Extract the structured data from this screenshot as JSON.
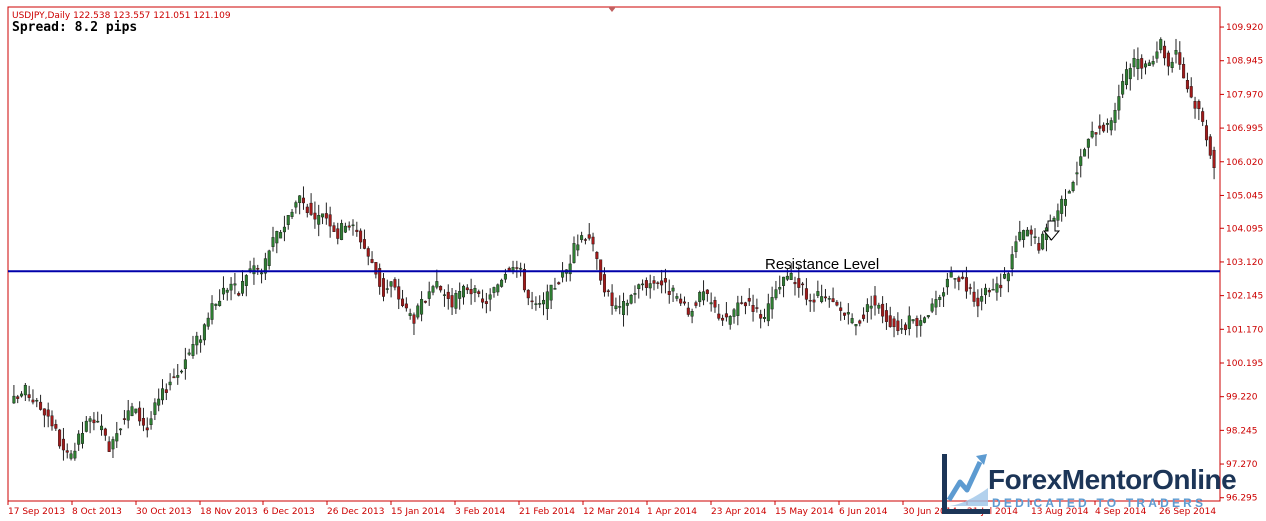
{
  "header": {
    "symbol_line": "USDJPY,Daily  122.538 123.557 121.051 121.109",
    "spread": "Spread: 8.2 pips"
  },
  "colors": {
    "frame": "#cc0000",
    "axis_text": "#cc0000",
    "bull_candle": "#2e7d32",
    "bear_candle": "#a11a1a",
    "wick": "#222222",
    "resistance_line": "#0000aa",
    "logo_dark": "#1c3557",
    "logo_accent": "#5d9bd1"
  },
  "logo": {
    "name": "ForexMentorOnline",
    "tagline": "DEDICATED TO TRADERS",
    "mark_icon": "chart-arrow-icon"
  },
  "annotation": {
    "label": "Resistance Level",
    "arrow_icon": "down-arrow-icon",
    "arrow_date": "13 Aug 2014"
  },
  "chart_data": {
    "type": "candlestick",
    "title": "USDJPY,Daily",
    "ylim": [
      96.2,
      110.5
    ],
    "y_ticks": [
      "109.920",
      "108.945",
      "107.970",
      "106.995",
      "106.020",
      "105.045",
      "104.095",
      "103.120",
      "102.145",
      "101.170",
      "100.195",
      "99.220",
      "98.245",
      "97.270",
      "96.295"
    ],
    "x_ticks": [
      "17 Sep 2013",
      "8 Oct 2013",
      "30 Oct 2013",
      "18 Nov 2013",
      "6 Dec 2013",
      "26 Dec 2013",
      "15 Jan 2014",
      "3 Feb 2014",
      "21 Feb 2014",
      "12 Mar 2014",
      "1 Apr 2014",
      "23 Apr 2014",
      "15 May 2014",
      "6 Jun 2014",
      "30 Jun 2014",
      "21 Jul 2014",
      "13 Aug 2014",
      "4 Sep 2014",
      "26 Sep 2014"
    ],
    "resistance_level": 102.85,
    "close_path": [
      [
        0,
        99.1
      ],
      [
        3,
        99.4
      ],
      [
        6,
        99.0
      ],
      [
        9,
        98.7
      ],
      [
        11,
        98.2
      ],
      [
        13,
        97.6
      ],
      [
        15,
        97.4
      ],
      [
        17,
        98.0
      ],
      [
        19,
        98.4
      ],
      [
        21,
        98.6
      ],
      [
        23,
        98.2
      ],
      [
        25,
        97.8
      ],
      [
        27,
        98.3
      ],
      [
        29,
        98.6
      ],
      [
        31,
        98.9
      ],
      [
        33,
        98.6
      ],
      [
        35,
        98.3
      ],
      [
        37,
        98.9
      ],
      [
        39,
        99.3
      ],
      [
        41,
        99.7
      ],
      [
        43,
        99.9
      ],
      [
        45,
        100.3
      ],
      [
        47,
        100.7
      ],
      [
        49,
        101.0
      ],
      [
        51,
        101.6
      ],
      [
        53,
        101.9
      ],
      [
        55,
        102.3
      ],
      [
        57,
        102.5
      ],
      [
        59,
        102.2
      ],
      [
        61,
        102.8
      ],
      [
        63,
        103.0
      ],
      [
        65,
        102.8
      ],
      [
        67,
        103.5
      ],
      [
        69,
        103.9
      ],
      [
        71,
        104.2
      ],
      [
        73,
        104.7
      ],
      [
        75,
        105.0
      ],
      [
        77,
        104.7
      ],
      [
        79,
        104.2
      ],
      [
        81,
        104.6
      ],
      [
        83,
        104.3
      ],
      [
        85,
        103.9
      ],
      [
        87,
        104.3
      ],
      [
        89,
        104.1
      ],
      [
        91,
        103.8
      ],
      [
        93,
        103.3
      ],
      [
        95,
        102.8
      ],
      [
        97,
        102.2
      ],
      [
        99,
        102.5
      ],
      [
        101,
        102.1
      ],
      [
        103,
        101.7
      ],
      [
        105,
        101.5
      ],
      [
        107,
        101.9
      ],
      [
        109,
        102.1
      ],
      [
        111,
        102.4
      ],
      [
        113,
        102.2
      ],
      [
        115,
        101.9
      ],
      [
        117,
        102.2
      ],
      [
        119,
        102.4
      ],
      [
        121,
        102.2
      ],
      [
        123,
        101.9
      ],
      [
        125,
        102.1
      ],
      [
        127,
        102.5
      ],
      [
        129,
        102.9
      ],
      [
        131,
        103.1
      ],
      [
        133,
        102.8
      ],
      [
        135,
        102.1
      ],
      [
        137,
        101.8
      ],
      [
        139,
        101.9
      ],
      [
        141,
        102.3
      ],
      [
        143,
        102.6
      ],
      [
        145,
        102.9
      ],
      [
        147,
        103.5
      ],
      [
        149,
        103.9
      ],
      [
        151,
        103.9
      ],
      [
        153,
        103.1
      ],
      [
        155,
        102.4
      ],
      [
        157,
        101.9
      ],
      [
        159,
        101.7
      ],
      [
        161,
        102.0
      ],
      [
        163,
        102.3
      ],
      [
        165,
        102.5
      ],
      [
        167,
        102.5
      ],
      [
        169,
        102.6
      ],
      [
        171,
        102.4
      ],
      [
        173,
        102.2
      ],
      [
        175,
        101.9
      ],
      [
        177,
        101.6
      ],
      [
        179,
        102.0
      ],
      [
        181,
        102.2
      ],
      [
        183,
        101.9
      ],
      [
        185,
        101.6
      ],
      [
        187,
        101.4
      ],
      [
        189,
        101.7
      ],
      [
        191,
        101.9
      ],
      [
        193,
        102.0
      ],
      [
        195,
        101.7
      ],
      [
        197,
        101.5
      ],
      [
        199,
        102.0
      ],
      [
        201,
        102.4
      ],
      [
        203,
        102.7
      ],
      [
        205,
        102.6
      ],
      [
        207,
        102.3
      ],
      [
        209,
        101.9
      ],
      [
        211,
        102.1
      ],
      [
        213,
        102.0
      ],
      [
        215,
        101.9
      ],
      [
        217,
        101.7
      ],
      [
        219,
        101.5
      ],
      [
        221,
        101.3
      ],
      [
        223,
        101.6
      ],
      [
        225,
        102.0
      ],
      [
        227,
        101.8
      ],
      [
        229,
        101.5
      ],
      [
        231,
        101.3
      ],
      [
        233,
        101.2
      ],
      [
        235,
        101.4
      ],
      [
        237,
        101.4
      ],
      [
        239,
        101.6
      ],
      [
        241,
        101.8
      ],
      [
        243,
        102.0
      ],
      [
        245,
        102.7
      ],
      [
        247,
        102.8
      ],
      [
        249,
        102.6
      ],
      [
        251,
        102.2
      ],
      [
        253,
        102.0
      ],
      [
        255,
        102.2
      ],
      [
        257,
        102.3
      ],
      [
        259,
        102.5
      ],
      [
        261,
        102.9
      ],
      [
        263,
        103.7
      ],
      [
        265,
        104.0
      ],
      [
        267,
        103.9
      ],
      [
        269,
        103.6
      ],
      [
        271,
        104.0
      ],
      [
        273,
        104.4
      ],
      [
        275,
        104.9
      ],
      [
        277,
        105.3
      ],
      [
        279,
        105.8
      ],
      [
        281,
        106.4
      ],
      [
        283,
        106.8
      ],
      [
        285,
        107.1
      ],
      [
        287,
        107.0
      ],
      [
        289,
        107.6
      ],
      [
        291,
        108.3
      ],
      [
        293,
        108.8
      ],
      [
        295,
        108.9
      ],
      [
        297,
        108.7
      ],
      [
        299,
        109.1
      ],
      [
        301,
        109.5
      ],
      [
        303,
        108.8
      ],
      [
        305,
        109.3
      ],
      [
        307,
        108.5
      ],
      [
        309,
        107.9
      ],
      [
        311,
        107.5
      ],
      [
        313,
        106.8
      ],
      [
        315,
        105.9
      ]
    ]
  }
}
